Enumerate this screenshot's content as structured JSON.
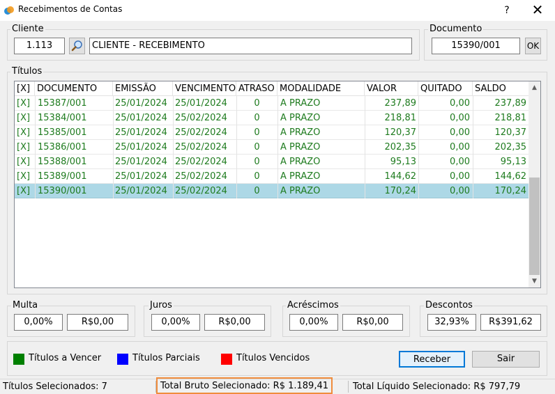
{
  "window": {
    "title": "Recebimentos de Contas",
    "help_label": "?",
    "close_label": "✕"
  },
  "cliente": {
    "legend": "Cliente",
    "code": "1.113",
    "name": "CLIENTE - RECEBIMENTO",
    "search_icon": "magnifier-icon"
  },
  "documento": {
    "legend": "Documento",
    "value": "15390/001",
    "ok_label": "OK"
  },
  "titulos": {
    "legend": "Títulos",
    "columns": [
      "[X]",
      "DOCUMENTO",
      "EMISSÃO",
      "VENCIMENTO",
      "ATRASO",
      "MODALIDADE",
      "VALOR",
      "QUITADO",
      "SALDO"
    ],
    "rows": [
      {
        "check": "[X]",
        "documento": "15387/001",
        "emissao": "25/01/2024",
        "vencimento": "25/01/2024",
        "atraso": "0",
        "modalidade": "A PRAZO",
        "valor": "237,89",
        "quitado": "0,00",
        "saldo": "237,89"
      },
      {
        "check": "[X]",
        "documento": "15384/001",
        "emissao": "25/01/2024",
        "vencimento": "25/02/2024",
        "atraso": "0",
        "modalidade": "A PRAZO",
        "valor": "218,81",
        "quitado": "0,00",
        "saldo": "218,81"
      },
      {
        "check": "[X]",
        "documento": "15385/001",
        "emissao": "25/01/2024",
        "vencimento": "25/02/2024",
        "atraso": "0",
        "modalidade": "A PRAZO",
        "valor": "120,37",
        "quitado": "0,00",
        "saldo": "120,37"
      },
      {
        "check": "[X]",
        "documento": "15386/001",
        "emissao": "25/01/2024",
        "vencimento": "25/02/2024",
        "atraso": "0",
        "modalidade": "A PRAZO",
        "valor": "202,35",
        "quitado": "0,00",
        "saldo": "202,35"
      },
      {
        "check": "[X]",
        "documento": "15388/001",
        "emissao": "25/01/2024",
        "vencimento": "25/02/2024",
        "atraso": "0",
        "modalidade": "A PRAZO",
        "valor": "95,13",
        "quitado": "0,00",
        "saldo": "95,13"
      },
      {
        "check": "[X]",
        "documento": "15389/001",
        "emissao": "25/01/2024",
        "vencimento": "25/02/2024",
        "atraso": "0",
        "modalidade": "A PRAZO",
        "valor": "144,62",
        "quitado": "0,00",
        "saldo": "144,62"
      },
      {
        "check": "[X]",
        "documento": "15390/001",
        "emissao": "25/01/2024",
        "vencimento": "25/02/2024",
        "atraso": "0",
        "modalidade": "A PRAZO",
        "valor": "170,24",
        "quitado": "0,00",
        "saldo": "170,24"
      }
    ],
    "selected_row_index": 6,
    "row_text_color": "#1e7b1e",
    "selected_row_color": "#add8e6"
  },
  "multa": {
    "legend": "Multa",
    "percent": "0,00%",
    "amount": "R$0,00"
  },
  "juros": {
    "legend": "Juros",
    "percent": "0,00%",
    "amount": "R$0,00"
  },
  "acrescimos": {
    "legend": "Acréscimos",
    "percent": "0,00%",
    "amount": "R$0,00"
  },
  "descontos": {
    "legend": "Descontos",
    "percent": "32,93%",
    "amount": "R$391,62"
  },
  "legend_items": [
    {
      "label": "Títulos a Vencer",
      "color": "#008000"
    },
    {
      "label": "Títulos Parciais",
      "color": "#0000ff"
    },
    {
      "label": "Títulos Vencidos",
      "color": "#ff0000"
    }
  ],
  "actions": {
    "receber_label": "Receber",
    "sair_label": "Sair"
  },
  "status": {
    "selecionados": "Títulos Selecionados: 7",
    "total_bruto": "Total Bruto Selecionado: R$ 1.189,41",
    "total_liquido": "Total Líquido Selecionado: R$ 797,79",
    "highlight_color": "#f08c3c"
  }
}
